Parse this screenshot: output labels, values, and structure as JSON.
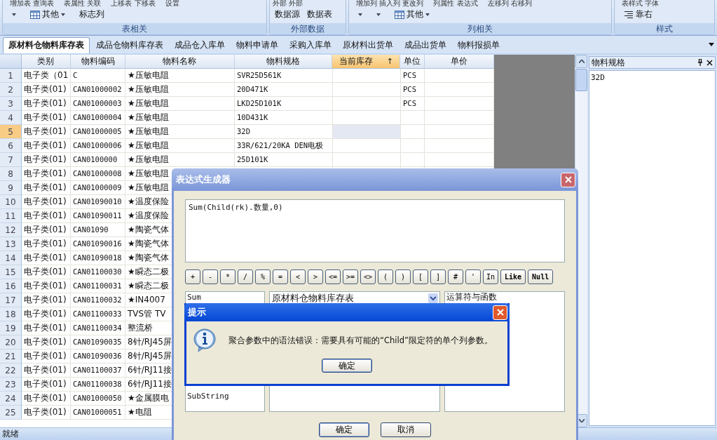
{
  "ribbon": {
    "groups": [
      {
        "label": "表相关",
        "captions": [
          "增加表 查询表",
          "表属性 关联",
          "上移表 下移表",
          "设置"
        ],
        "buttons": [
          {
            "kind": "caret"
          },
          {
            "kind": "table-menu",
            "text": "其他"
          },
          {
            "kind": "text",
            "text": "标志列"
          }
        ]
      },
      {
        "label": "外部数据",
        "captions": [
          "外部 外部"
        ],
        "buttons": [
          {
            "kind": "text",
            "text": "数据源"
          },
          {
            "kind": "text",
            "text": "数据表"
          }
        ]
      },
      {
        "label": "列相关",
        "captions": [
          "增加列 插入列 更改列",
          "列属性 表达式",
          "左移列 右移列"
        ],
        "buttons": [
          {
            "kind": "caret"
          },
          {
            "kind": "caret"
          },
          {
            "kind": "table-menu",
            "text": "其他"
          }
        ]
      },
      {
        "label": "样式",
        "captions": [
          "表样式 字体"
        ],
        "buttons": [
          {
            "kind": "align",
            "text": "靠右"
          }
        ]
      }
    ]
  },
  "tabs": [
    {
      "label": "原材料仓物料库存表",
      "selected": true
    },
    {
      "label": "成品仓物料库存表",
      "selected": false
    },
    {
      "label": "成品仓入库单",
      "selected": false
    },
    {
      "label": "物料申请单",
      "selected": false
    },
    {
      "label": "采购入库单",
      "selected": false
    },
    {
      "label": "原材料出货单",
      "selected": false
    },
    {
      "label": "成品出货单",
      "selected": false
    },
    {
      "label": "物料报损单",
      "selected": false
    }
  ],
  "table": {
    "columns": [
      {
        "label": "类别",
        "sorted": false
      },
      {
        "label": "物料编码",
        "sorted": false
      },
      {
        "label": "物料名称",
        "sorted": false
      },
      {
        "label": "物料规格",
        "sorted": false
      },
      {
        "label": "当前库存",
        "sorted": true,
        "sort_mark": "↑"
      },
      {
        "label": "单位",
        "sorted": false
      },
      {
        "label": "单价",
        "sorted": false
      }
    ],
    "rows": [
      {
        "n": "1",
        "category": "电子类（01",
        "code": "C",
        "name": "★压敏电阻",
        "spec": "SVR25D561K",
        "unit": "PCS",
        "selected": false
      },
      {
        "n": "2",
        "category": "电子类(01)",
        "code": "CAN01000002",
        "name": "★压敏电阻",
        "spec": "20D471K",
        "unit": "PCS",
        "selected": false
      },
      {
        "n": "3",
        "category": "电子类(01)",
        "code": "CAN01000003",
        "name": "★压敏电阻",
        "spec": "LKD25D101K",
        "unit": "PCS",
        "selected": false
      },
      {
        "n": "4",
        "category": "电子类(01)",
        "code": "CAN01000004",
        "name": "★压敏电阻",
        "spec": "10D431K",
        "selected": false
      },
      {
        "n": "5",
        "category": "电子类(01)",
        "code": "CAN01000005",
        "name": "★压敏电阻",
        "spec": "32D",
        "selected": true
      },
      {
        "n": "6",
        "category": "电子类(01)",
        "code": "CAN01000006",
        "name": "★压敏电阻",
        "spec": "33R/621/20KA DEN电极",
        "selected": false
      },
      {
        "n": "7",
        "category": "电子类(01)",
        "code": "CAN0100000",
        "name": "★压敏电阻",
        "spec": "25D101K",
        "selected": false
      },
      {
        "n": "8",
        "category": "电子类(01)",
        "code": "CAN01000008",
        "name": "★压敏电阻",
        "selected": false
      },
      {
        "n": "9",
        "category": "电子类(01)",
        "code": "CAN01000009",
        "name": "★压敏电阻",
        "selected": false
      },
      {
        "n": "10",
        "category": "电子类(01)",
        "code": "CAN01090010",
        "name": "★温度保险",
        "selected": false
      },
      {
        "n": "11",
        "category": "电子类(01)",
        "code": "CAN01090011",
        "name": "★温度保险",
        "selected": false
      },
      {
        "n": "12",
        "category": "电子类(01)",
        "code": "CAN01090",
        "name": "★陶瓷气体",
        "selected": false
      },
      {
        "n": "13",
        "category": "电子类(01)",
        "code": "CAN01090016",
        "name": "★陶瓷气体",
        "selected": false
      },
      {
        "n": "14",
        "category": "电子类(01)",
        "code": "CAN01090018",
        "name": "★陶瓷气体",
        "selected": false
      },
      {
        "n": "15",
        "category": "电子类(01)",
        "code": "CAN01100030",
        "name": "★瞬态二极",
        "selected": false
      },
      {
        "n": "16",
        "category": "电子类(01)",
        "code": "CAN01100031",
        "name": "★瞬态二极",
        "selected": false
      },
      {
        "n": "17",
        "category": "电子类(01)",
        "code": "CAN01100032",
        "name": "★IN4007",
        "selected": false
      },
      {
        "n": "18",
        "category": "电子类(01)",
        "code": "CAN01100033",
        "name": "TVS管 TV",
        "selected": false
      },
      {
        "n": "19",
        "category": "电子类(01)",
        "code": "CAN01100034",
        "name": "整流桥",
        "selected": false
      },
      {
        "n": "20",
        "category": "电子类(01)",
        "code": "CAN01090035",
        "name": "8针/RJ45屏",
        "selected": false
      },
      {
        "n": "21",
        "category": "电子类(01)",
        "code": "CAN01090036",
        "name": "8针/RJ45屏",
        "selected": false
      },
      {
        "n": "22",
        "category": "电子类(01)",
        "code": "CAN01100037",
        "name": "6针/RJ11接",
        "selected": false
      },
      {
        "n": "23",
        "category": "电子类(01)",
        "code": "CAN01100038",
        "name": "6针/RJ11接",
        "selected": false
      },
      {
        "n": "24",
        "category": "电子类(01)",
        "code": "CAN01000050",
        "name": "★金属膜电",
        "selected": false
      },
      {
        "n": "25",
        "category": "电子类(01)",
        "code": "CAN01000051",
        "name": "★电阻",
        "selected": false
      }
    ]
  },
  "side_panel": {
    "title": "物料规格",
    "value": "32D"
  },
  "status_bar": "就绪",
  "expression_dialog": {
    "title": "表达式生成器",
    "expression": "Sum(Child(rk).数量,0)",
    "operators": [
      "+",
      "-",
      "*",
      "/",
      "%",
      "=",
      "<",
      ">",
      "<=",
      ">=",
      "<>",
      "(",
      ")",
      "[",
      "]",
      "#",
      "'",
      "In",
      "Like",
      "Null"
    ],
    "functions": [
      "Sum",
      "SubString"
    ],
    "table_select": "原材料仓物料库存表",
    "categories": [
      "运算符与函数"
    ],
    "buttons": [
      "确定",
      "取消"
    ]
  },
  "alert": {
    "title": "提示",
    "message": "聚合参数中的语法错误：需要具有可能的“Child”限定符的单个列参数。",
    "button": "确定"
  }
}
